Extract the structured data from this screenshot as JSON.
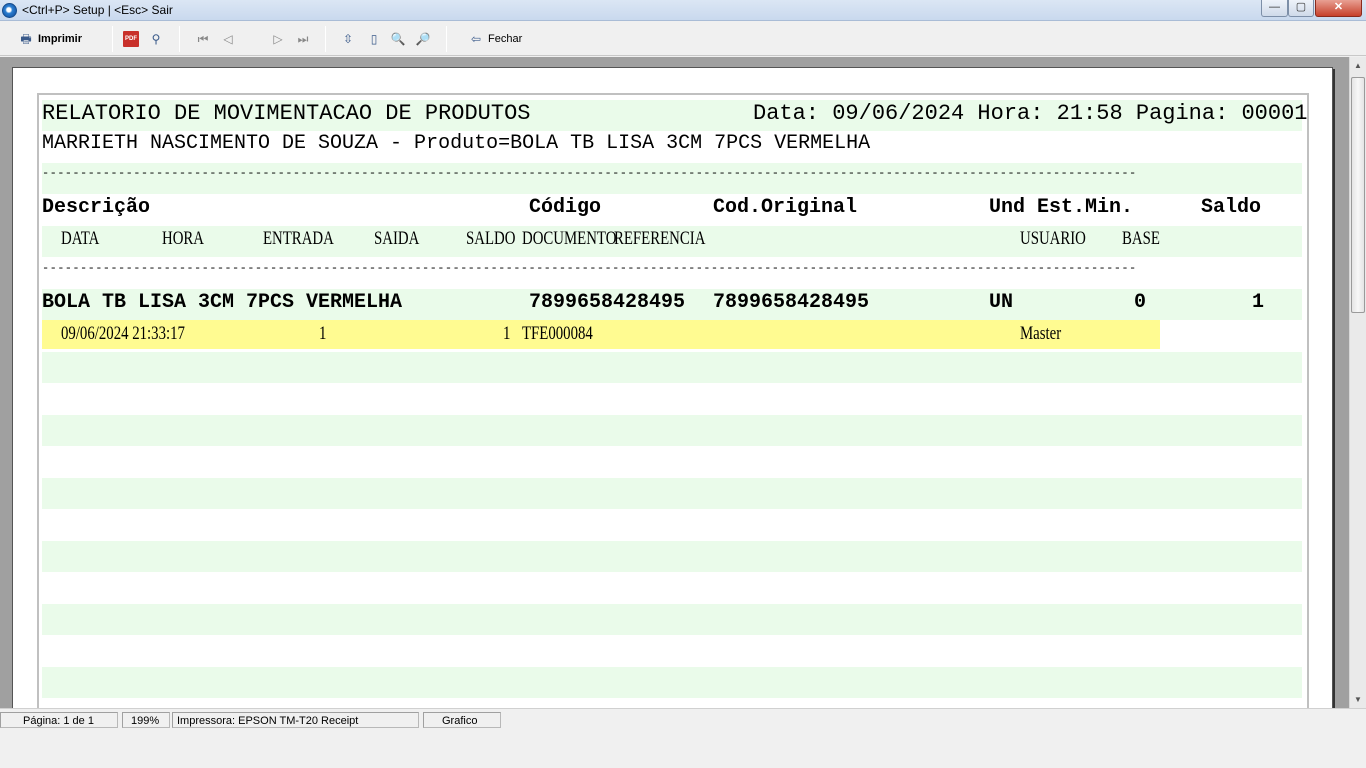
{
  "window": {
    "title": "<Ctrl+P> Setup | <Esc> Sair",
    "min_label": "—",
    "max_label": "▢",
    "close_label": "✕"
  },
  "toolbar": {
    "print_label": "Imprimir",
    "close_label": "Fechar",
    "pdf_icon_text": "PDF"
  },
  "report": {
    "title": "RELATORIO DE MOVIMENTACAO DE PRODUTOS",
    "date_info": "Data: 09/06/2024 Hora: 21:58 Pagina: 00001",
    "subtitle": "MARRIETH NASCIMENTO DE SOUZA - Produto=BOLA TB LISA 3CM 7PCS VERMELHA",
    "separator": "------------------------------------------------------------------------------------------------------------------------------------------------",
    "header1": {
      "descricao": "Descrição",
      "codigo": "Código",
      "cod_original": "Cod.Original",
      "und_est_min": "Und Est.Min.",
      "saldo": "Saldo"
    },
    "header2": {
      "data": "DATA",
      "hora": "HORA",
      "entrada": "ENTRADA",
      "saida": "SAIDA",
      "saldo": "SALDO",
      "documento": "DOCUMENTO",
      "referencia": "REFERENCIA",
      "usuario": "USUARIO",
      "base": "BASE"
    },
    "product": {
      "descricao": "BOLA TB LISA 3CM 7PCS VERMELHA",
      "codigo": "7899658428495",
      "cod_original": "7899658428495",
      "und": "UN",
      "est_min": "0",
      "saldo": "1"
    },
    "movements": [
      {
        "data_hora": "09/06/2024 21:33:17",
        "entrada": "1",
        "saldo": "1",
        "documento": "TFE000084",
        "usuario": "Master"
      }
    ]
  },
  "status": {
    "pagina": "Página: 1 de 1",
    "zoom": "199%",
    "impressora": "Impressora: EPSON TM-T20 Receipt",
    "modo": "Grafico"
  },
  "colors": {
    "band_green": "#eafbea",
    "band_yellow": "#fffb91",
    "preview_bg": "#a0a0a0"
  }
}
